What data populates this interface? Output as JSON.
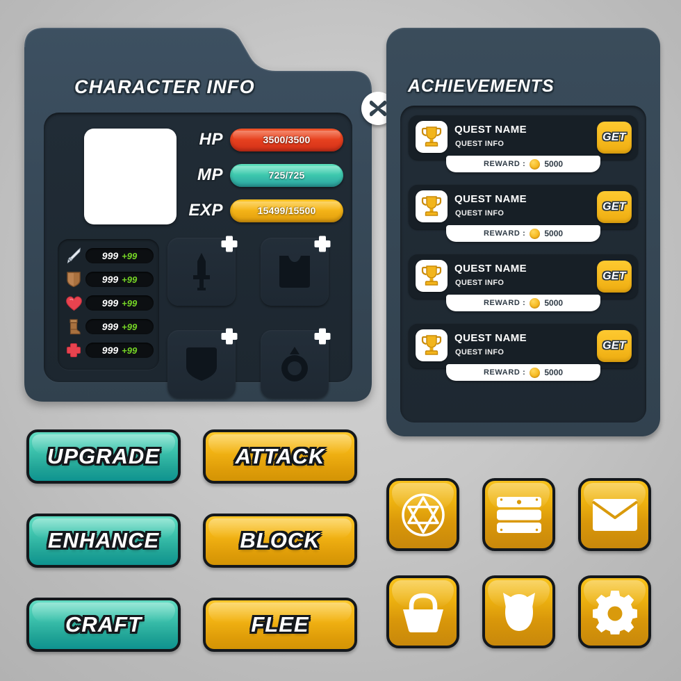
{
  "character_panel": {
    "title": "CHARACTER INFO",
    "close_icon": "close-x-icon",
    "avatar_placeholder": "",
    "bars": [
      {
        "label": "HP",
        "value": "3500/3500",
        "color": "#e8421f"
      },
      {
        "label": "MP",
        "value": "725/725",
        "color": "#3ec9ae"
      },
      {
        "label": "EXP",
        "value": "15499/15500",
        "color": "#f5b518"
      }
    ],
    "stats": [
      {
        "icon": "sword-icon",
        "value": "999",
        "bonus": "+99"
      },
      {
        "icon": "shield-icon",
        "value": "999",
        "bonus": "+99"
      },
      {
        "icon": "heart-icon",
        "value": "999",
        "bonus": "+99"
      },
      {
        "icon": "boot-icon",
        "value": "999",
        "bonus": "+99"
      },
      {
        "icon": "cross-icon",
        "value": "999",
        "bonus": "+99"
      }
    ],
    "equipment_slots": [
      {
        "icon": "sword-slot-icon",
        "add": "+"
      },
      {
        "icon": "armor-slot-icon",
        "add": "+"
      },
      {
        "icon": "shield-slot-icon",
        "add": "+"
      },
      {
        "icon": "ring-slot-icon",
        "add": "+"
      }
    ]
  },
  "achievements_panel": {
    "title": "ACHIEVEMENTS",
    "close_icon": "close-x-icon",
    "quests": [
      {
        "icon": "trophy-icon",
        "name": "QUEST NAME",
        "info": "QUEST INFO",
        "action": "GET",
        "reward_label": "REWARD :",
        "reward_amount": "5000",
        "coin_icon": "coin-icon"
      },
      {
        "icon": "trophy-icon",
        "name": "QUEST NAME",
        "info": "QUEST INFO",
        "action": "GET",
        "reward_label": "REWARD :",
        "reward_amount": "5000",
        "coin_icon": "coin-icon"
      },
      {
        "icon": "trophy-icon",
        "name": "QUEST NAME",
        "info": "QUEST INFO",
        "action": "GET",
        "reward_label": "REWARD :",
        "reward_amount": "5000",
        "coin_icon": "coin-icon"
      },
      {
        "icon": "trophy-icon",
        "name": "QUEST NAME",
        "info": "QUEST INFO",
        "action": "GET",
        "reward_label": "REWARD :",
        "reward_amount": "5000",
        "coin_icon": "coin-icon"
      }
    ]
  },
  "action_buttons": [
    {
      "label": "UPGRADE",
      "style": "teal"
    },
    {
      "label": "ATTACK",
      "style": "gold"
    },
    {
      "label": "ENHANCE",
      "style": "teal"
    },
    {
      "label": "BLOCK",
      "style": "gold"
    },
    {
      "label": "CRAFT",
      "style": "teal"
    },
    {
      "label": "FLEE",
      "style": "gold"
    }
  ],
  "icon_buttons": [
    {
      "icon": "hexagram-circle-icon"
    },
    {
      "icon": "drawer-icon"
    },
    {
      "icon": "envelope-icon"
    },
    {
      "icon": "basket-icon"
    },
    {
      "icon": "cat-head-icon"
    },
    {
      "icon": "gear-icon"
    }
  ],
  "colors": {
    "panel_bg": "#354654",
    "panel_inner": "#202a34",
    "accent_gold": "#f3b414",
    "accent_teal": "#3fc4ae",
    "accent_red": "#e8421f",
    "bonus_green": "#76d626",
    "background": "#c8c8c8"
  }
}
